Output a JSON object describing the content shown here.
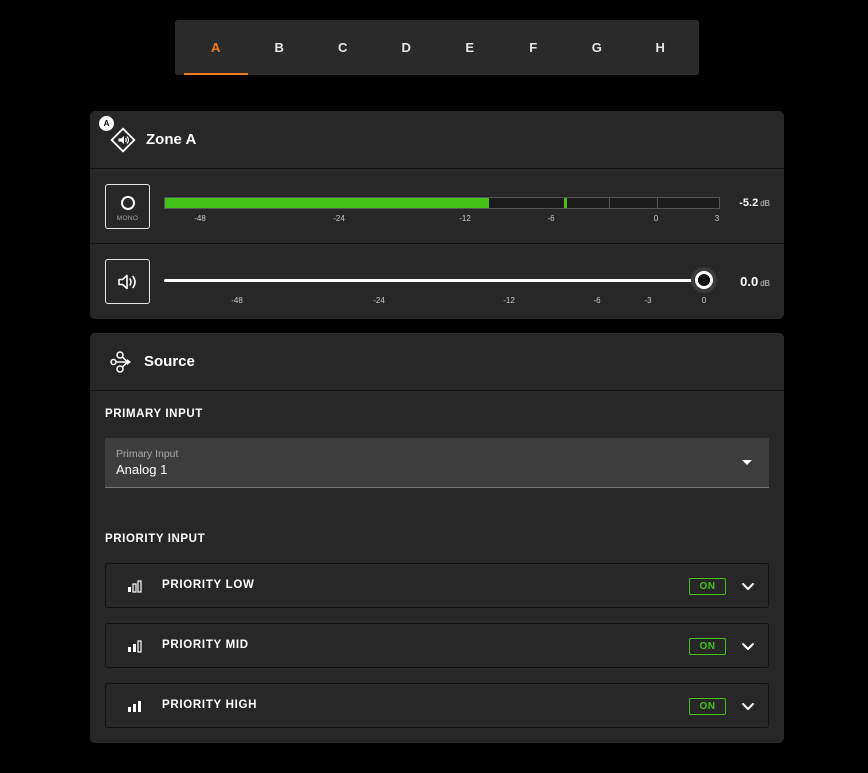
{
  "tabs": [
    {
      "label": "A",
      "active": true
    },
    {
      "label": "B"
    },
    {
      "label": "C"
    },
    {
      "label": "D"
    },
    {
      "label": "E"
    },
    {
      "label": "F"
    },
    {
      "label": "G"
    },
    {
      "label": "H"
    }
  ],
  "zone": {
    "badge": "A",
    "title": "Zone A",
    "mono_label": "MONO",
    "meter": {
      "scale": [
        "-48",
        "-24",
        "-12",
        "-6",
        "0",
        "3"
      ],
      "level_fraction": 0.585,
      "peak_fraction": 0.72,
      "readout_value": "-5.2",
      "readout_unit": "dB"
    },
    "volume": {
      "scale": [
        "-48",
        "-24",
        "-12",
        "-6",
        "-3",
        "0"
      ],
      "value_fraction": 1.0,
      "readout_value": "0.0",
      "readout_unit": "dB"
    }
  },
  "source": {
    "title": "Source",
    "primary_section": "PRIMARY INPUT",
    "primary_placeholder": "Primary Input",
    "primary_value": "Analog 1",
    "priority_section": "PRIORITY INPUT",
    "priorities": [
      {
        "label": "PRIORITY LOW",
        "state": "ON",
        "level": 1
      },
      {
        "label": "PRIORITY MID",
        "state": "ON",
        "level": 2
      },
      {
        "label": "PRIORITY HIGH",
        "state": "ON",
        "level": 3
      }
    ]
  },
  "colors": {
    "accent": "#f07a1e",
    "meter_green": "#45c21a"
  }
}
